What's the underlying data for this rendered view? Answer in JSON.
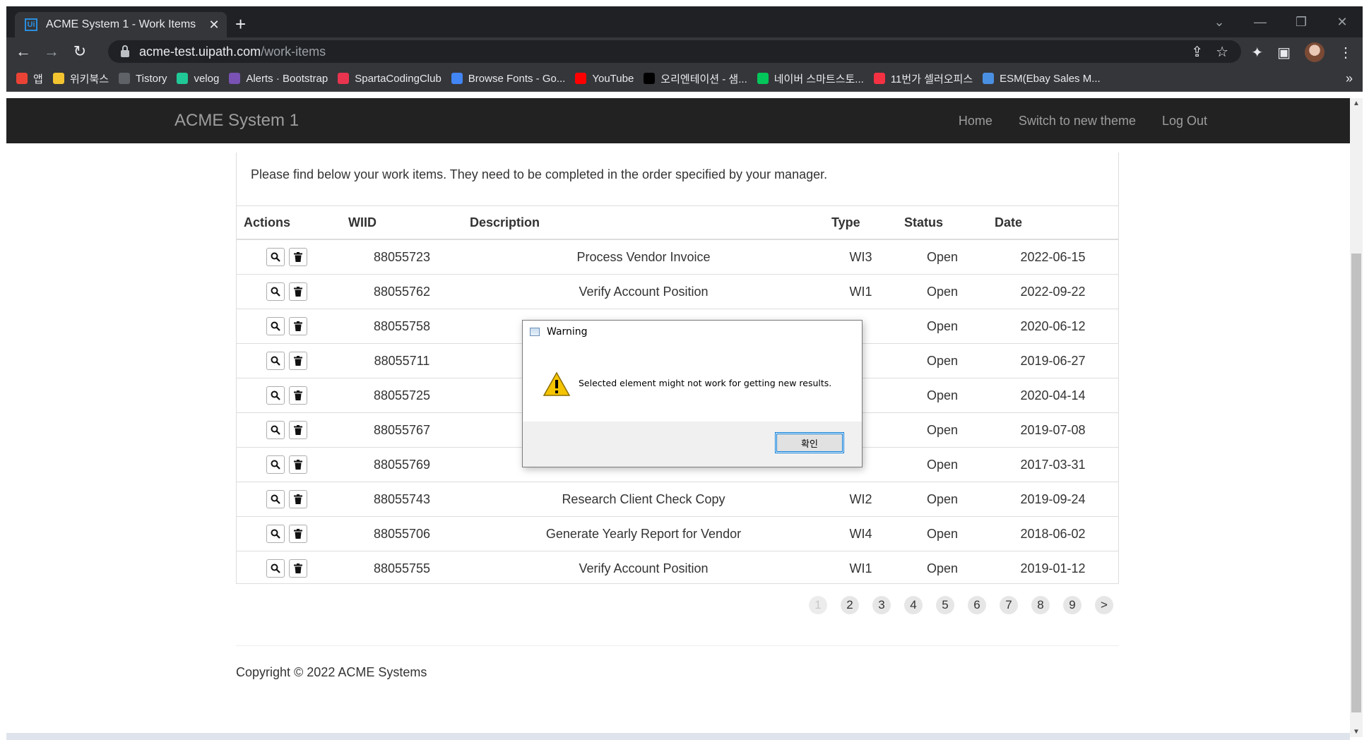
{
  "browser": {
    "tab_title": "ACME System 1 - Work Items",
    "tab_favicon": "Ui",
    "url_host": "acme-test.uipath.com",
    "url_path": "/work-items",
    "bookmarks": [
      {
        "label": "앱",
        "icon": "apps-grid-icon",
        "color": "#ea4335"
      },
      {
        "label": "위키북스",
        "icon": "folder-icon",
        "color": "#f4c430"
      },
      {
        "label": "Tistory",
        "icon": "tistory-icon",
        "color": "#5f6368"
      },
      {
        "label": "velog",
        "icon": "velog-icon",
        "color": "#20c997"
      },
      {
        "label": "Alerts · Bootstrap",
        "icon": "bootstrap-icon",
        "color": "#7952b3"
      },
      {
        "label": "SpartaCodingClub",
        "icon": "sparta-icon",
        "color": "#e8344e"
      },
      {
        "label": "Browse Fonts - Go...",
        "icon": "google-fonts-icon",
        "color": "#4285f4"
      },
      {
        "label": "YouTube",
        "icon": "youtube-icon",
        "color": "#ff0000"
      },
      {
        "label": "오리엔테이션 - 샘...",
        "icon": "circle-icon",
        "color": "#000000"
      },
      {
        "label": "네이버 스마트스토...",
        "icon": "naver-smartstore-icon",
        "color": "#03c75a"
      },
      {
        "label": "11번가 셀러오피스",
        "icon": "11st-icon",
        "color": "#f43142"
      },
      {
        "label": "ESM(Ebay Sales M...",
        "icon": "esm-icon",
        "color": "#4a90e2"
      }
    ],
    "bookmarks_more": "»"
  },
  "navbar": {
    "brand": "ACME System 1",
    "links": [
      "Home",
      "Switch to new theme",
      "Log Out"
    ]
  },
  "main": {
    "intro": "Please find below your work items. They need to be completed in the order specified by your manager.",
    "columns": [
      "Actions",
      "WIID",
      "Description",
      "Type",
      "Status",
      "Date"
    ],
    "rows": [
      {
        "wiid": "88055723",
        "description": "Process Vendor Invoice",
        "type": "WI3",
        "status": "Open",
        "date": "2022-06-15"
      },
      {
        "wiid": "88055762",
        "description": "Verify Account Position",
        "type": "WI1",
        "status": "Open",
        "date": "2022-09-22"
      },
      {
        "wiid": "88055758",
        "description": "",
        "type": "",
        "status": "Open",
        "date": "2020-06-12"
      },
      {
        "wiid": "88055711",
        "description": "",
        "type": "",
        "status": "Open",
        "date": "2019-06-27"
      },
      {
        "wiid": "88055725",
        "description": "",
        "type": "",
        "status": "Open",
        "date": "2020-04-14"
      },
      {
        "wiid": "88055767",
        "description": "",
        "type": "",
        "status": "Open",
        "date": "2019-07-08"
      },
      {
        "wiid": "88055769",
        "description": "",
        "type": "",
        "status": "Open",
        "date": "2017-03-31"
      },
      {
        "wiid": "88055743",
        "description": "Research Client Check Copy",
        "type": "WI2",
        "status": "Open",
        "date": "2019-09-24"
      },
      {
        "wiid": "88055706",
        "description": "Generate Yearly Report for Vendor",
        "type": "WI4",
        "status": "Open",
        "date": "2018-06-02"
      },
      {
        "wiid": "88055755",
        "description": "Verify Account Position",
        "type": "WI1",
        "status": "Open",
        "date": "2019-01-12"
      }
    ],
    "pagination": [
      "1",
      "2",
      "3",
      "4",
      "5",
      "6",
      "7",
      "8",
      "9",
      ">"
    ],
    "current_page": "1"
  },
  "footer": {
    "copyright": "Copyright © 2022 ACME Systems"
  },
  "dialog": {
    "title": "Warning",
    "message": "Selected element might not work for getting new results.",
    "ok_label": "확인"
  }
}
